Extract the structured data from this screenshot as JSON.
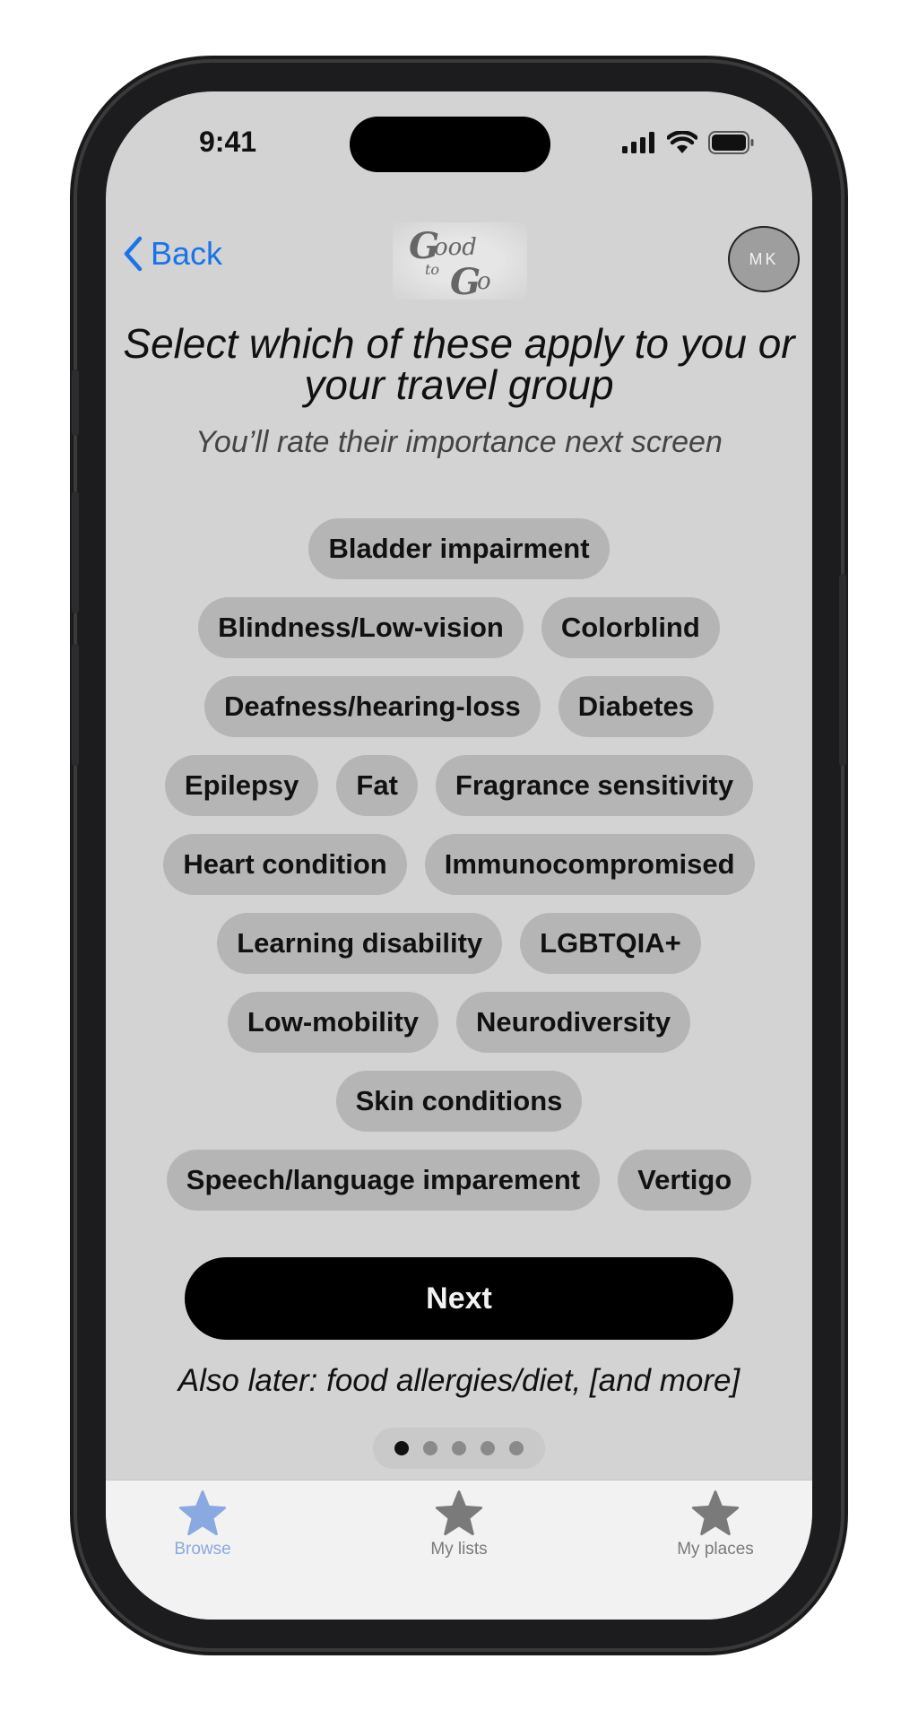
{
  "status_bar": {
    "time": "9:41"
  },
  "nav": {
    "back_label": "Back",
    "avatar_initials": "MK",
    "logo_text": "Good to Go"
  },
  "content": {
    "headline": "Select which of these apply to you or your travel group",
    "subhead": "You’ll rate their importance next screen",
    "chip_rows": [
      [
        "Bladder impairment"
      ],
      [
        "Blindness/Low-vision",
        "Colorblind"
      ],
      [
        "Deafness/hearing-loss",
        "Diabetes"
      ],
      [
        "Epilepsy",
        "Fat",
        "Fragrance sensitivity"
      ],
      [
        "Heart condition",
        "Immunocompromised"
      ],
      [
        "Learning disability",
        "LGBTQIA+"
      ],
      [
        "Low-mobility",
        "Neurodiversity"
      ],
      [
        "Skin conditions"
      ],
      [
        "Speech/language imparement",
        "Vertigo"
      ]
    ],
    "next_label": "Next",
    "later_text": "Also later: food allergies/diet, [and more]",
    "page_dots": {
      "count": 5,
      "active_index": 0
    }
  },
  "tab_bar": {
    "tabs": [
      {
        "label": "Browse",
        "icon": "star-icon",
        "selected": true
      },
      {
        "label": "My lists",
        "icon": "star-icon",
        "selected": false
      },
      {
        "label": "My places",
        "icon": "star-icon",
        "selected": false
      }
    ]
  },
  "colors": {
    "accent": "#1a73e8",
    "selected_tab": "#8aa9e0",
    "unselected_tab": "#7a7a7a",
    "chip_bg": "#b5b5b5",
    "screen_bg": "#d3d3d3"
  }
}
